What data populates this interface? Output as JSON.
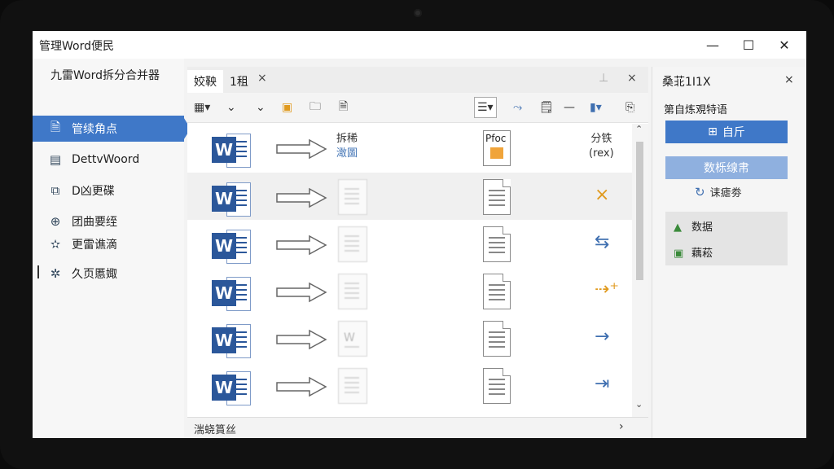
{
  "window": {
    "title": "管理Word便民",
    "minimize": "—",
    "maximize": "☐",
    "close": "✕"
  },
  "sidebar": {
    "app_name": "九雷Word拆分合并器",
    "items": [
      {
        "label": "管续角点",
        "icon": "document-icon"
      },
      {
        "label": "DettvWoord",
        "icon": "document-lines-icon"
      },
      {
        "label": "D凶更碟",
        "icon": "split-icon"
      },
      {
        "label": "团曲要绖",
        "icon": "globe-icon"
      },
      {
        "label": "更雷谯滴",
        "icon": "star-icon"
      },
      {
        "label": "久页慝娵",
        "icon": "settings-icon"
      }
    ]
  },
  "tabs": [
    {
      "label": "姣鞅"
    },
    {
      "label": "1租"
    }
  ],
  "tab_close": "×",
  "tabbar_pin": "⊥",
  "tabbar_close": "×",
  "list_header": {
    "col1_title": "拆稀",
    "col1_sub": "澉圖",
    "col2_doc": "Pfoc",
    "col3_title": "分铁",
    "col3_sub": "(rex)"
  },
  "rows": [
    {
      "action": "×",
      "action_name": "remove-icon",
      "color": "#e09a1e",
      "ghost_w": ""
    },
    {
      "action": "⇆",
      "action_name": "swap-arrows-icon",
      "color": "#3f6fb0",
      "ghost_w": ""
    },
    {
      "action": "⇢⁺",
      "action_name": "merge-arrow-icon",
      "color": "#e09a1e",
      "ghost_w": ""
    },
    {
      "action": "→",
      "action_name": "arrow-right-icon",
      "color": "#3f6fb0",
      "ghost_w": "W"
    },
    {
      "action": "⇥",
      "action_name": "arrow-to-end-icon",
      "color": "#3f6fb0",
      "ghost_w": ""
    }
  ],
  "statusbar": {
    "text": "湍蛲篔丝",
    "chevron": "›"
  },
  "right_panel": {
    "title": "桑苝1I1X",
    "close": "×",
    "subtitle": "第自炼覌特语",
    "primary_button": "自斤",
    "secondary_button": "数栎缐帇",
    "link": "诔瘧劵",
    "group_items": [
      {
        "label": "数据",
        "icon": "triangle-icon",
        "color": "#3a8a3a"
      },
      {
        "label": "藕菘",
        "icon": "table-icon",
        "color": "#3a8a3a"
      }
    ]
  },
  "colors": {
    "accent": "#3f78c8",
    "word_blue": "#2b579a"
  }
}
